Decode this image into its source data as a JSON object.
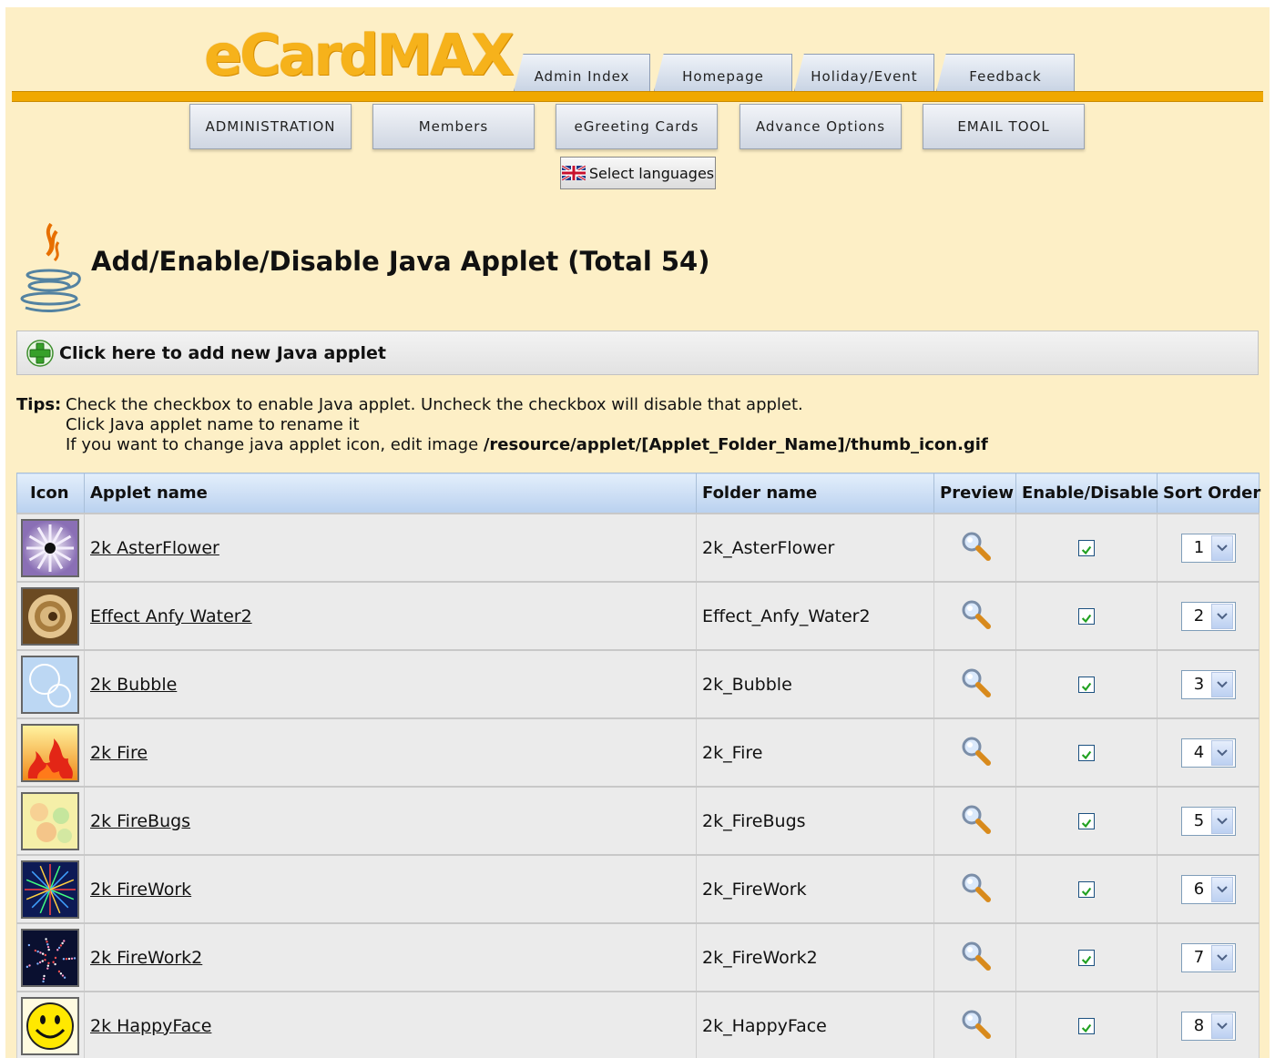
{
  "header": {
    "logo": "eCardMAX",
    "top_tabs": [
      {
        "label": "Admin Index"
      },
      {
        "label": "Homepage"
      },
      {
        "label": "Holiday/Event"
      },
      {
        "label": "Feedback"
      }
    ],
    "sub_tabs": [
      {
        "label": "ADMINISTRATION"
      },
      {
        "label": "Members"
      },
      {
        "label": "eGreeting Cards"
      },
      {
        "label": "Advance Options"
      },
      {
        "label": "EMAIL TOOL"
      }
    ],
    "language_button": "Select languages"
  },
  "page": {
    "title": "Add/Enable/Disable Java Applet (Total 54)",
    "add_link": "Click here to add new Java applet"
  },
  "tips": {
    "label": "Tips:",
    "line1": "Check the checkbox to enable Java applet. Uncheck the checkbox will disable that applet.",
    "line2": "Click Java applet name to rename it",
    "line3_prefix": "If you want to change java applet icon, edit image ",
    "line3_path": "/resource/applet/[Applet_Folder_Name]/thumb_icon.gif"
  },
  "table": {
    "headers": {
      "icon": "Icon",
      "name": "Applet name",
      "folder": "Folder name",
      "preview": "Preview",
      "enable": "Enable/Disable",
      "sort": "Sort Order"
    },
    "rows": [
      {
        "name": "2k AsterFlower",
        "folder": "2k_AsterFlower",
        "enabled": true,
        "sort": "1",
        "icon": "aster-flower-thumb"
      },
      {
        "name": "Effect Anfy Water2",
        "folder": "Effect_Anfy_Water2",
        "enabled": true,
        "sort": "2",
        "icon": "water-ripple-thumb"
      },
      {
        "name": "2k Bubble",
        "folder": "2k_Bubble",
        "enabled": true,
        "sort": "3",
        "icon": "bubble-thumb"
      },
      {
        "name": "2k Fire",
        "folder": "2k_Fire",
        "enabled": true,
        "sort": "4",
        "icon": "fire-thumb"
      },
      {
        "name": "2k FireBugs",
        "folder": "2k_FireBugs",
        "enabled": true,
        "sort": "5",
        "icon": "firebugs-thumb"
      },
      {
        "name": "2k FireWork",
        "folder": "2k_FireWork",
        "enabled": true,
        "sort": "6",
        "icon": "firework-thumb"
      },
      {
        "name": "2k FireWork2",
        "folder": "2k_FireWork2",
        "enabled": true,
        "sort": "7",
        "icon": "firework2-thumb"
      },
      {
        "name": "2k HappyFace",
        "folder": "2k_HappyFace",
        "enabled": true,
        "sort": "8",
        "icon": "happy-face-thumb"
      }
    ]
  },
  "colors": {
    "page_bg": "#fdefc6",
    "accent_bar": "#f0a800",
    "logo": "#f6b21b",
    "header_row": "#c9dbf2",
    "row_bg": "#ebebeb"
  }
}
